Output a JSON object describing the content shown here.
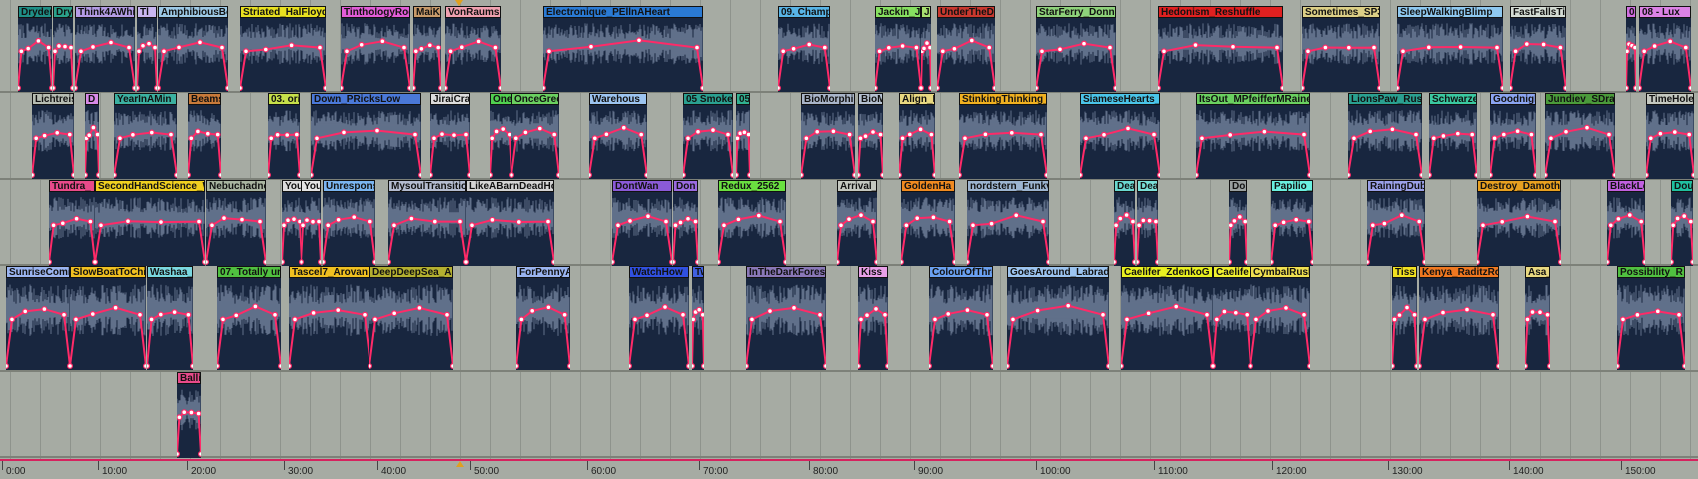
{
  "colors": {
    "clip_body": "#18263f",
    "automation": "#ff2a68",
    "background": "#a6aba3"
  },
  "timeline": {
    "labels": [
      "0:00",
      "10:00",
      "20:00",
      "30:00",
      "40:00",
      "50:00",
      "60:00",
      "70:00",
      "80:00",
      "90:00",
      "100:00",
      "110:00",
      "120:00",
      "130:00",
      "140:00",
      "150:00"
    ]
  },
  "lanes": [
    [
      {
        "n": "Dryden",
        "c": "#1f8f86"
      },
      {
        "n": "Dryi",
        "c": "#2aa08a"
      },
      {
        "n": "Think4AWhi",
        "c": "#b49ce6"
      },
      {
        "n": "Tl",
        "c": "#c9b7f0"
      },
      {
        "n": "AmphibiousBo",
        "c": "#9dc9e6"
      },
      {
        "n": "Striated_HalFloyd",
        "c": "#e8e020"
      },
      {
        "n": "TinthologyRoc",
        "c": "#e25cd8"
      },
      {
        "n": "MaiKa",
        "c": "#c89a6a"
      },
      {
        "n": "VonRaums",
        "c": "#f0a0b0"
      },
      {
        "n": "Electronique_PEllnAHeart",
        "c": "#2a7ad4"
      },
      {
        "n": "09. Champ",
        "c": "#58b4e6"
      },
      {
        "n": "Jackin_J",
        "c": "#86e060"
      },
      {
        "n": "Jac",
        "c": "#a8e070"
      },
      {
        "n": "UnderTheD",
        "c": "#c8382e"
      },
      {
        "n": "StarFerry_Donna",
        "c": "#8ed27a"
      },
      {
        "n": "Hedonism_Reshuffle",
        "c": "#e02020"
      },
      {
        "n": "Sometimes_SP3",
        "c": "#dccf86"
      },
      {
        "n": "SleepWalkingBlimp",
        "c": "#8ec8f0"
      },
      {
        "n": "FastFallsTi",
        "c": "#d4dcd4"
      },
      {
        "n": "08",
        "c": "#d06ee0"
      },
      {
        "n": "08 - Lux",
        "c": "#dc82e6"
      }
    ],
    [
      {
        "n": "Lichtreis",
        "c": "#b6bcb2"
      },
      {
        "n": "D",
        "c": "#d88ae8"
      },
      {
        "n": "YearInAMin",
        "c": "#3bb0a0"
      },
      {
        "n": "Beams",
        "c": "#c87a3a"
      },
      {
        "n": "03. ori",
        "c": "#c6e04a"
      },
      {
        "n": "Down_PRicksLow",
        "c": "#4a78d8"
      },
      {
        "n": "JiraiCra",
        "c": "#dcdcdc"
      },
      {
        "n": "One",
        "c": "#50d050"
      },
      {
        "n": "OnceGree",
        "c": "#6ad060"
      },
      {
        "n": "Warehous",
        "c": "#9cc4f0"
      },
      {
        "n": "05 Smoke",
        "c": "#2aa090"
      },
      {
        "n": "05",
        "c": "#30b090"
      },
      {
        "n": "BioMorphi",
        "c": "#a8b4c8"
      },
      {
        "n": "BioM",
        "c": "#b4c0d0"
      },
      {
        "n": "Align_Ri",
        "c": "#e8d880"
      },
      {
        "n": "StinkingThinking_",
        "c": "#f0b020"
      },
      {
        "n": "SiameseHearts_",
        "c": "#4ac4e8"
      },
      {
        "n": "ItsOut_MPfeifferMRainer",
        "c": "#6ad060"
      },
      {
        "n": "LionsPaw_Rusk",
        "c": "#2aa090"
      },
      {
        "n": "Schwarzeh",
        "c": "#3ac8a0"
      },
      {
        "n": "Goodnigh",
        "c": "#8aa4f0"
      },
      {
        "n": "Jundiev_SDrak",
        "c": "#4a9a3a"
      },
      {
        "n": "TimeHole",
        "c": "#c4c8c0"
      }
    ],
    [
      {
        "n": "Tundra_",
        "c": "#e84a8a"
      },
      {
        "n": "SecondHandScience_W",
        "c": "#f0d020"
      },
      {
        "n": "Nebuchadne",
        "c": "#a8b4a0"
      },
      {
        "n": "You",
        "c": "#dcdcdc"
      },
      {
        "n": "You",
        "c": "#e4e4e4"
      },
      {
        "n": "Unresponsi",
        "c": "#7ab4f0"
      },
      {
        "n": "MysoulTransitio",
        "c": "#b4bcd0"
      },
      {
        "n": "LikeABarnDeadHo",
        "c": "#d4d4d4"
      },
      {
        "n": "DontWan",
        "c": "#8a5ad8"
      },
      {
        "n": "Don",
        "c": "#9a6ae0"
      },
      {
        "n": "Redux_2562",
        "c": "#6ae040"
      },
      {
        "n": "Arrival_",
        "c": "#c4c8c0"
      },
      {
        "n": "GoldenHa",
        "c": "#f08a20"
      },
      {
        "n": "nordstern_Funkv",
        "c": "#9cb4d0"
      },
      {
        "n": "Dea",
        "c": "#6ad8d0"
      },
      {
        "n": "Dead",
        "c": "#7ae0d8"
      },
      {
        "n": "Do",
        "c": "#9aa0a0"
      },
      {
        "n": "Papilio_",
        "c": "#6af0e0"
      },
      {
        "n": "RainingDub",
        "c": "#9aa0e8"
      },
      {
        "n": "Destroy_Damoth3",
        "c": "#e8a020"
      },
      {
        "n": "BlackLe",
        "c": "#c060e0"
      },
      {
        "n": "Dou",
        "c": "#20c0a0"
      }
    ],
    [
      {
        "n": "SunriseComi",
        "c": "#9ab4f0"
      },
      {
        "n": "SlowBoatToChi",
        "c": "#f0c020"
      },
      {
        "n": "Washaa_",
        "c": "#7ad8e0"
      },
      {
        "n": "07. Totally ur",
        "c": "#50c040"
      },
      {
        "n": "Tascel7_Arovan",
        "c": "#f0c020"
      },
      {
        "n": "DeepDeepSea_As",
        "c": "#b4b030"
      },
      {
        "n": "ForPennyA",
        "c": "#9ab4f0"
      },
      {
        "n": "WatchHow",
        "c": "#3050e0"
      },
      {
        "n": "Tw",
        "c": "#4060e0"
      },
      {
        "n": "InTheDarkForest",
        "c": "#8a78b8"
      },
      {
        "n": "Kiss",
        "c": "#e8a0e8"
      },
      {
        "n": "ColourOfThre",
        "c": "#6aa0f0"
      },
      {
        "n": "GoesAround_Labrad",
        "c": "#9cc4f0"
      },
      {
        "n": "Caelifer_ZdenkoG",
        "c": "#e8f020"
      },
      {
        "n": "Caelife",
        "c": "#f0f030"
      },
      {
        "n": "CymbalRush",
        "c": "#f0e050"
      },
      {
        "n": "Tiss",
        "c": "#f0e020"
      },
      {
        "n": "Kenya_RaditzRoo",
        "c": "#f07820"
      },
      {
        "n": "Asa_",
        "c": "#e8d880"
      },
      {
        "n": "Possibility_R",
        "c": "#50c040"
      }
    ],
    [
      {
        "n": "Balli",
        "c": "#e84a8a"
      }
    ]
  ]
}
